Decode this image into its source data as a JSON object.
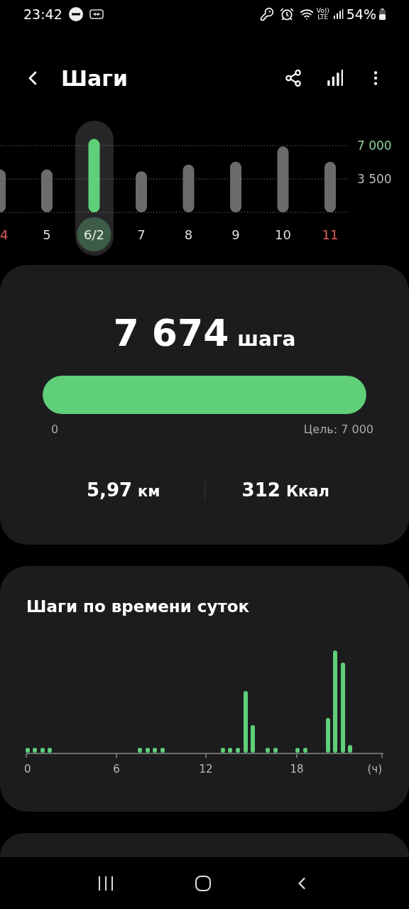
{
  "status_bar": {
    "time": "23:42",
    "network_top": "Vo))",
    "network_bottom": "LTE",
    "battery": "54%"
  },
  "header": {
    "title": "Шаги"
  },
  "daily_chart": {
    "days": [
      {
        "weekend": true,
        "selected": false
      },
      {
        "weekend": false,
        "selected": false
      },
      {
        "weekend": false,
        "selected": true
      },
      {
        "weekend": false,
        "selected": false
      },
      {
        "weekend": false,
        "selected": false
      },
      {
        "weekend": false,
        "selected": false
      },
      {
        "weekend": false,
        "selected": false
      },
      {
        "weekend": true,
        "selected": false
      }
    ],
    "chart_data": {
      "type": "bar",
      "categories": [
        "4",
        "5",
        "6/2",
        "7",
        "8",
        "9",
        "10",
        "11"
      ],
      "series": [
        {
          "color": "#6b6b6b",
          "values": [
            4500,
            4500,
            null,
            4300,
            5000,
            5300,
            6900,
            5300
          ]
        },
        {
          "color": "#5fcf78",
          "values": [
            null,
            null,
            7700,
            null,
            null,
            null,
            null,
            null
          ]
        }
      ],
      "ylim": [
        0,
        7700
      ],
      "yticks": [
        {
          "value": 3500,
          "label": "3 500"
        },
        {
          "value": 7000,
          "label": "7 000"
        }
      ]
    }
  },
  "summary": {
    "steps": "7 674",
    "steps_unit": "шага",
    "progress": {
      "level": 1
    },
    "progress_start": "0",
    "goal": "Цель: 7 000",
    "distance": "5,97",
    "distance_unit": "км",
    "calories": "312",
    "calories_unit": "Ккал"
  },
  "hourly": {
    "title": "Шаги по времени суток",
    "axis_labels": [
      "0",
      "6",
      "12",
      "18",
      "(ч)"
    ]
  }
}
